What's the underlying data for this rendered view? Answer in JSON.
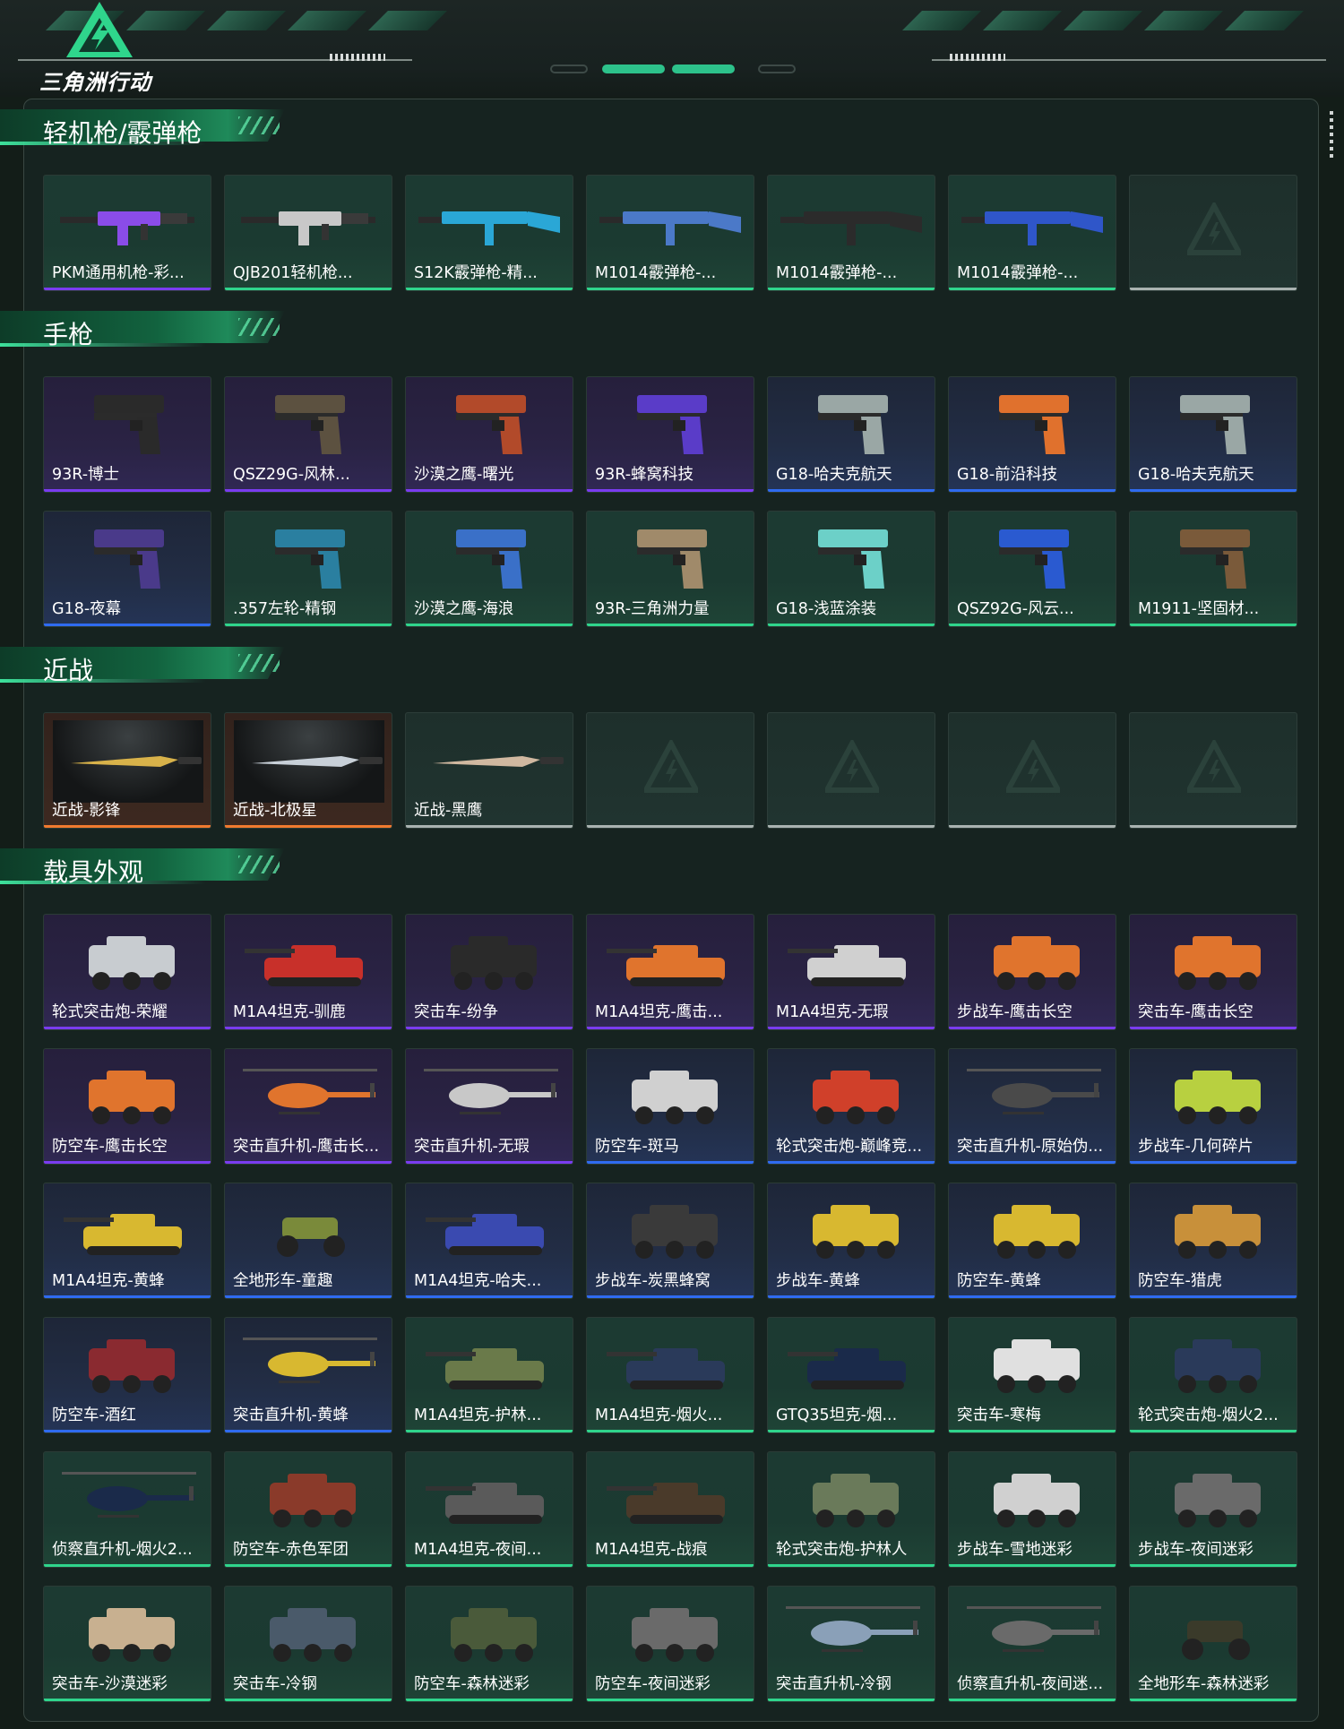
{
  "header": {
    "logo_text": "三角洲行动"
  },
  "sections": [
    {
      "title": "轻机枪/霰弹枪",
      "items": [
        {
          "label": "PKM通用机枪-彩...",
          "rarity": "purple-on-green",
          "icon": "machine-gun",
          "color": "#8a4ce8"
        },
        {
          "label": "QJB201轻机枪...",
          "rarity": "green",
          "icon": "machine-gun",
          "color": "#c8c8c8"
        },
        {
          "label": "S12K霰弹枪-精...",
          "rarity": "green",
          "icon": "shotgun",
          "color": "#2aa7d6"
        },
        {
          "label": "M1014霰弹枪-...",
          "rarity": "green",
          "icon": "shotgun",
          "color": "#4b79c8"
        },
        {
          "label": "M1014霰弹枪-...",
          "rarity": "green",
          "icon": "shotgun",
          "color": "#2b2b2b"
        },
        {
          "label": "M1014霰弹枪-...",
          "rarity": "green",
          "icon": "shotgun",
          "color": "#2f56c9"
        },
        {
          "label": "",
          "rarity": "empty",
          "icon": "empty-slot",
          "color": ""
        }
      ]
    },
    {
      "title": "手枪",
      "items": [
        {
          "label": "93R-博士",
          "rarity": "purple",
          "icon": "pistol",
          "color": "#2a2a2a"
        },
        {
          "label": "QSZ29G-风林...",
          "rarity": "purple",
          "icon": "pistol",
          "color": "#5c5140"
        },
        {
          "label": "沙漠之鹰-曙光",
          "rarity": "purple",
          "icon": "pistol",
          "color": "#b24a2a"
        },
        {
          "label": "93R-蜂窝科技",
          "rarity": "purple",
          "icon": "pistol",
          "color": "#5a3cc8"
        },
        {
          "label": "G18-哈夫克航天",
          "rarity": "blue",
          "icon": "pistol",
          "color": "#9aa7a5"
        },
        {
          "label": "G18-前沿科技",
          "rarity": "blue",
          "icon": "pistol",
          "color": "#e0712d"
        },
        {
          "label": "G18-哈夫克航天",
          "rarity": "blue",
          "icon": "pistol",
          "color": "#9aa7a5"
        },
        {
          "label": "G18-夜幕",
          "rarity": "blue",
          "icon": "pistol",
          "color": "#4a3a8a"
        },
        {
          "label": ".357左轮-精钢",
          "rarity": "green",
          "icon": "revolver",
          "color": "#2a7fa0"
        },
        {
          "label": "沙漠之鹰-海浪",
          "rarity": "green",
          "icon": "pistol",
          "color": "#3a70c8"
        },
        {
          "label": "93R-三角洲力量",
          "rarity": "green",
          "icon": "pistol",
          "color": "#a08a6a"
        },
        {
          "label": "G18-浅蓝涂装",
          "rarity": "green",
          "icon": "pistol",
          "color": "#6cd0c8"
        },
        {
          "label": "QSZ92G-风云...",
          "rarity": "green",
          "icon": "pistol",
          "color": "#2a5ad0"
        },
        {
          "label": "M1911-坚固材...",
          "rarity": "green",
          "icon": "pistol",
          "color": "#7a5a3a"
        }
      ]
    },
    {
      "title": "近战",
      "items": [
        {
          "label": "近战-影锋",
          "rarity": "orange",
          "icon": "knife",
          "color": "#d8b24a"
        },
        {
          "label": "近战-北极星",
          "rarity": "orange",
          "icon": "knife",
          "color": "#c8d0d8"
        },
        {
          "label": "近战-黑鹰",
          "rarity": "empty-line",
          "icon": "knife",
          "color": "#d0b8a0"
        },
        {
          "label": "",
          "rarity": "empty",
          "icon": "empty-slot",
          "color": ""
        },
        {
          "label": "",
          "rarity": "empty",
          "icon": "empty-slot",
          "color": ""
        },
        {
          "label": "",
          "rarity": "empty",
          "icon": "empty-slot",
          "color": ""
        },
        {
          "label": "",
          "rarity": "empty",
          "icon": "empty-slot",
          "color": ""
        }
      ]
    },
    {
      "title": "载具外观",
      "items": [
        {
          "label": "轮式突击炮-荣耀",
          "rarity": "purple",
          "icon": "armored-car",
          "color": "#c8ccd0"
        },
        {
          "label": "M1A4坦克-驯鹿",
          "rarity": "purple",
          "icon": "tank",
          "color": "#c8302a"
        },
        {
          "label": "突击车-纷争",
          "rarity": "purple",
          "icon": "truck",
          "color": "#2a2a2a"
        },
        {
          "label": "M1A4坦克-鹰击...",
          "rarity": "purple",
          "icon": "tank",
          "color": "#e0742d"
        },
        {
          "label": "M1A4坦克-无瑕",
          "rarity": "purple",
          "icon": "tank",
          "color": "#d0d0d0"
        },
        {
          "label": "步战车-鹰击长空",
          "rarity": "purple",
          "icon": "ifv",
          "color": "#e0742d"
        },
        {
          "label": "突击车-鹰击长空",
          "rarity": "purple",
          "icon": "truck",
          "color": "#e0742d"
        },
        {
          "label": "防空车-鹰击长空",
          "rarity": "purple",
          "icon": "ifv",
          "color": "#e0742d"
        },
        {
          "label": "突击直升机-鹰击长...",
          "rarity": "purple",
          "icon": "helicopter",
          "color": "#e0742d"
        },
        {
          "label": "突击直升机-无瑕",
          "rarity": "purple",
          "icon": "helicopter",
          "color": "#c8c8c8"
        },
        {
          "label": "防空车-斑马",
          "rarity": "blue",
          "icon": "ifv",
          "color": "#d0d0d0"
        },
        {
          "label": "轮式突击炮-巅峰竞...",
          "rarity": "blue",
          "icon": "armored-car",
          "color": "#d0402a"
        },
        {
          "label": "突击直升机-原始伪...",
          "rarity": "blue",
          "icon": "helicopter",
          "color": "#4a4a4a"
        },
        {
          "label": "步战车-几何碎片",
          "rarity": "blue",
          "icon": "ifv",
          "color": "#b8d040"
        },
        {
          "label": "M1A4坦克-黄蜂",
          "rarity": "blue",
          "icon": "tank",
          "color": "#d8b830"
        },
        {
          "label": "全地形车-童趣",
          "rarity": "blue",
          "icon": "atv",
          "color": "#7a8a3a"
        },
        {
          "label": "M1A4坦克-哈夫...",
          "rarity": "blue",
          "icon": "tank",
          "color": "#3a4ab0"
        },
        {
          "label": "步战车-炭黑蜂窝",
          "rarity": "blue",
          "icon": "ifv",
          "color": "#3a3a3a"
        },
        {
          "label": "步战车-黄蜂",
          "rarity": "blue",
          "icon": "ifv",
          "color": "#d8b830"
        },
        {
          "label": "防空车-黄蜂",
          "rarity": "blue",
          "icon": "ifv",
          "color": "#d8b830"
        },
        {
          "label": "防空车-猎虎",
          "rarity": "blue",
          "icon": "ifv",
          "color": "#c8903a"
        },
        {
          "label": "防空车-酒红",
          "rarity": "blue",
          "icon": "ifv",
          "color": "#8a2a30"
        },
        {
          "label": "突击直升机-黄蜂",
          "rarity": "blue",
          "icon": "helicopter",
          "color": "#d8b830"
        },
        {
          "label": "M1A4坦克-护林...",
          "rarity": "green",
          "icon": "tank",
          "color": "#6a7a4a"
        },
        {
          "label": "M1A4坦克-烟火...",
          "rarity": "green",
          "icon": "tank",
          "color": "#2a3a5a"
        },
        {
          "label": "GTQ35坦克-烟...",
          "rarity": "green",
          "icon": "tank",
          "color": "#1a2a4a"
        },
        {
          "label": "突击车-寒梅",
          "rarity": "green",
          "icon": "truck",
          "color": "#e0e0e0"
        },
        {
          "label": "轮式突击炮-烟火2...",
          "rarity": "green",
          "icon": "armored-car",
          "color": "#2a3a5a"
        },
        {
          "label": "侦察直升机-烟火2...",
          "rarity": "green",
          "icon": "helicopter",
          "color": "#1a2a4a"
        },
        {
          "label": "防空车-赤色军团",
          "rarity": "green",
          "icon": "ifv",
          "color": "#8a3a2a"
        },
        {
          "label": "M1A4坦克-夜间...",
          "rarity": "green",
          "icon": "tank",
          "color": "#5a5a5a"
        },
        {
          "label": "M1A4坦克-战痕",
          "rarity": "green",
          "icon": "tank",
          "color": "#4a3a2a"
        },
        {
          "label": "轮式突击炮-护林人",
          "rarity": "green",
          "icon": "armored-car",
          "color": "#6a7a5a"
        },
        {
          "label": "步战车-雪地迷彩",
          "rarity": "green",
          "icon": "ifv",
          "color": "#d0d0d0"
        },
        {
          "label": "步战车-夜间迷彩",
          "rarity": "green",
          "icon": "ifv",
          "color": "#6a6a6a"
        },
        {
          "label": "突击车-沙漠迷彩",
          "rarity": "green",
          "icon": "truck",
          "color": "#c8b090"
        },
        {
          "label": "突击车-冷钢",
          "rarity": "green",
          "icon": "truck",
          "color": "#4a5a6a"
        },
        {
          "label": "防空车-森林迷彩",
          "rarity": "green",
          "icon": "ifv",
          "color": "#4a5a3a"
        },
        {
          "label": "防空车-夜间迷彩",
          "rarity": "green",
          "icon": "ifv",
          "color": "#6a6a6a"
        },
        {
          "label": "突击直升机-冷钢",
          "rarity": "green",
          "icon": "helicopter",
          "color": "#8aa0b8"
        },
        {
          "label": "侦察直升机-夜间迷...",
          "rarity": "green",
          "icon": "helicopter",
          "color": "#6a6a6a"
        },
        {
          "label": "全地形车-森林迷彩",
          "rarity": "green",
          "icon": "atv",
          "color": "#3a3a2a"
        }
      ]
    }
  ],
  "colors": {
    "green": "#2fd58c",
    "purple": "#7a3cf0",
    "blue": "#2f6bf0",
    "orange": "#f07a2f",
    "empty": "#a9b2b0"
  }
}
